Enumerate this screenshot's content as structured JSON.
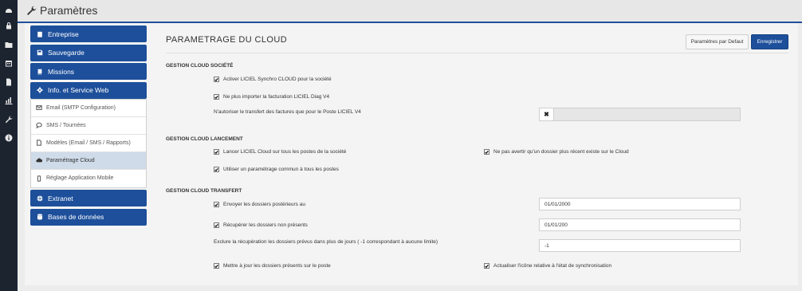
{
  "rail_icons": [
    "dashboard-icon",
    "lock-icon",
    "folder-icon",
    "calendar-icon",
    "document-icon",
    "chart-icon",
    "wrench-icon",
    "info-icon"
  ],
  "header": {
    "title": "Paramètres"
  },
  "sidebar": {
    "groups": [
      {
        "label": "Entreprise",
        "icon": "building-icon"
      },
      {
        "label": "Sauvegarde",
        "icon": "save-icon"
      },
      {
        "label": "Missions",
        "icon": "book-icon"
      },
      {
        "label": "Info. et Service Web",
        "icon": "gear-icon"
      }
    ],
    "subitems": [
      {
        "label": "Email (SMTP Configuration)",
        "icon": "envelope-icon"
      },
      {
        "label": "SMS / Tournées",
        "icon": "chat-icon"
      },
      {
        "label": "Modèles (Email / SMS / Rapports)",
        "icon": "file-icon"
      },
      {
        "label": "Paramétrage Cloud",
        "icon": "cloud-icon",
        "active": true
      },
      {
        "label": "Réglage Application Mobile",
        "icon": "mobile-icon"
      }
    ],
    "groups_after": [
      {
        "label": "Extranet",
        "icon": "globe-icon"
      },
      {
        "label": "Bases de données",
        "icon": "database-icon"
      }
    ]
  },
  "main": {
    "title": "PARAMETRAGE DU CLOUD",
    "btn_default": "Paramètres par Defaut",
    "btn_save": "Enregistrer",
    "section1": "GESTION CLOUD SOCIÉTÉ",
    "s1_chk1": "Activer LICIEL Synchro CLOUD pour la société",
    "s1_chk2": "Ne plus importer la facturation LICIEL Diag V4",
    "s1_label3": "N'autoriser le transfert des factures que pour le Poste LICIEL V4",
    "section2": "GESTION CLOUD LANCEMENT",
    "s2_chk1": "Lancer LICIEL Cloud sur tous les postes de la société",
    "s2_chk2": "Ne pas avertir qu'un dossier plus récent existe sur le Cloud",
    "s2_chk3": "Utiliser un paramétrage commun à tous les postes",
    "section3": "GESTION CLOUD TRANSFERT",
    "s3_chk1": "Envoyer les dossiers postérieurs au",
    "s3_val1": "01/01/2000",
    "s3_chk2": "Récupérer les dossiers non présents",
    "s3_val2": "01/01/200",
    "s3_label3": "Exclure la récupération les dossiers prévus dans plus de jours ( -1 correspondant à aucune limite)",
    "s3_val3": "-1",
    "s3_chk4": "Mettre à jour les dossiers présents sur le poste",
    "s3_chk5": "Actualiser l'icône relative à l'état de synchronisation"
  }
}
